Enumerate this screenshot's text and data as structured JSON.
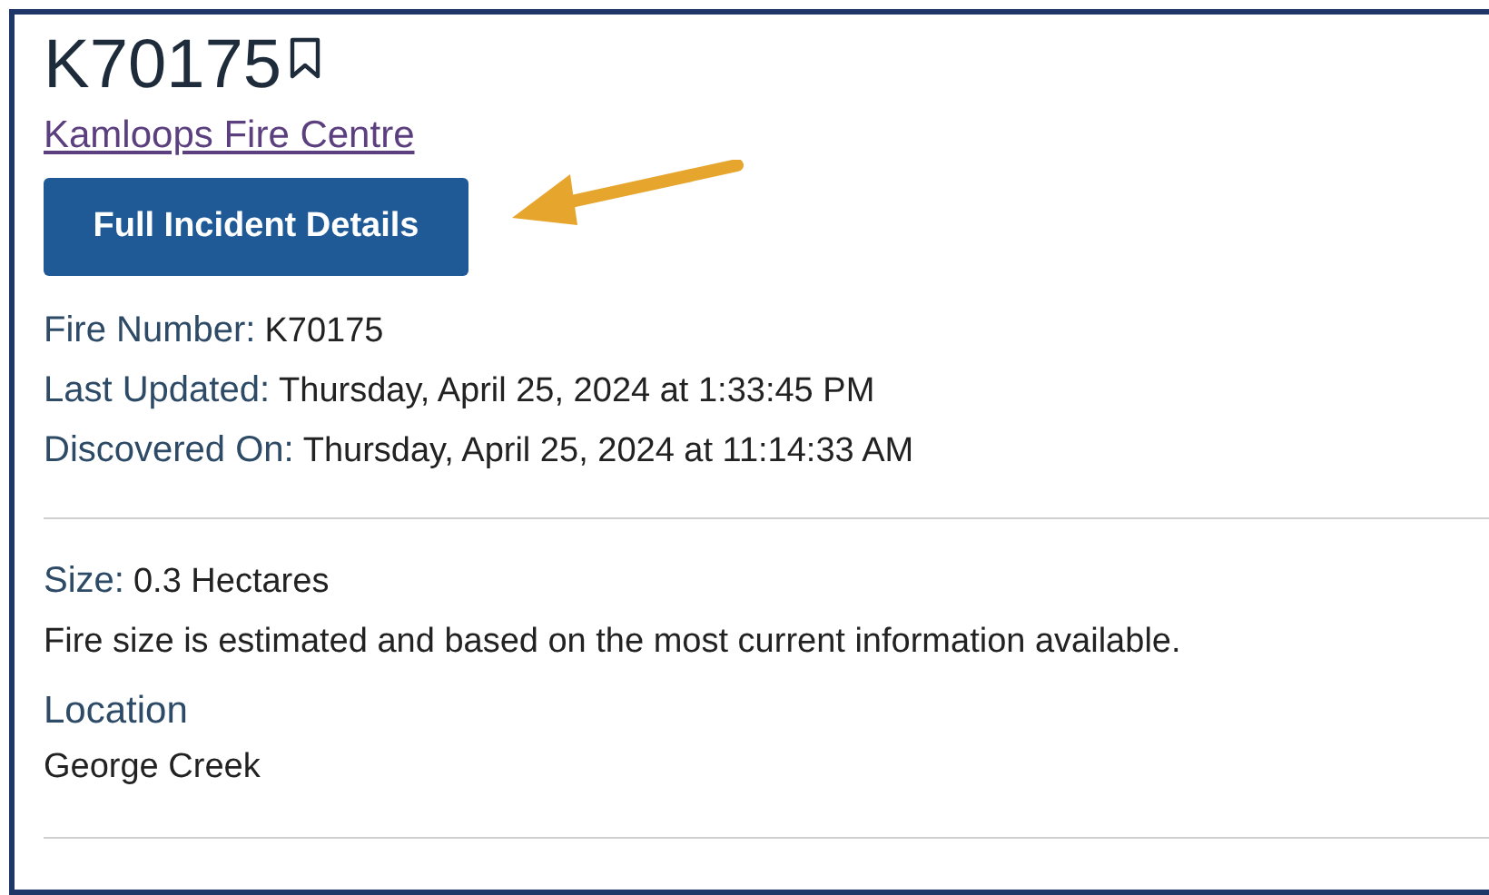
{
  "incident": {
    "fire_id": "K70175",
    "fire_centre_link": "Kamloops Fire Centre",
    "button": "Full Incident Details",
    "details": [
      {
        "label": "Fire Number:",
        "value": "K70175"
      },
      {
        "label": "Last Updated:",
        "value": "Thursday, April 25, 2024 at 1:33:45 PM"
      },
      {
        "label": "Discovered On:",
        "value": "Thursday, April 25, 2024 at 11:14:33 AM"
      }
    ],
    "size": {
      "label": "Size:",
      "value": "0.3 Hectares"
    },
    "size_note": "Fire size is estimated and based on the most current information available.",
    "location": {
      "heading": "Location",
      "value": "George Creek"
    }
  }
}
